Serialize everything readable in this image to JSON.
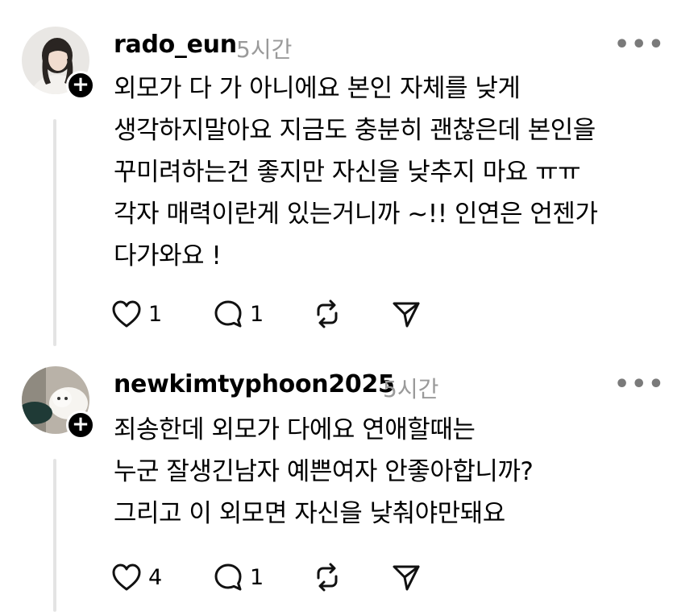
{
  "comments": [
    {
      "username": "rado_eun",
      "time": "5시간",
      "lines": [
        "외모가 다 가 아니에요 본인 자체를 낮게",
        "생각하지말아요 지금도 충분히 괜찮은데 본인을",
        "꾸미려하는건 좋지만 자신을 낮추지 마요 ㅠㅠ",
        "각자 매력이란게 있는거니까 ~!! 인연은 언젠가",
        "다가와요 !"
      ],
      "likes": "1",
      "replies": "1"
    },
    {
      "username": "newkimtyphoon2025",
      "time": "5시간",
      "lines": [
        "죄송한데 외모가 다에요 연애할때는",
        "누군 잘생긴남자 예쁜여자 안좋아합니까?",
        "그리고 이 외모면 자신을 낮춰야만돼요"
      ],
      "likes": "4",
      "replies": "1"
    }
  ],
  "follow_symbol": "+",
  "more_symbol": "•••"
}
